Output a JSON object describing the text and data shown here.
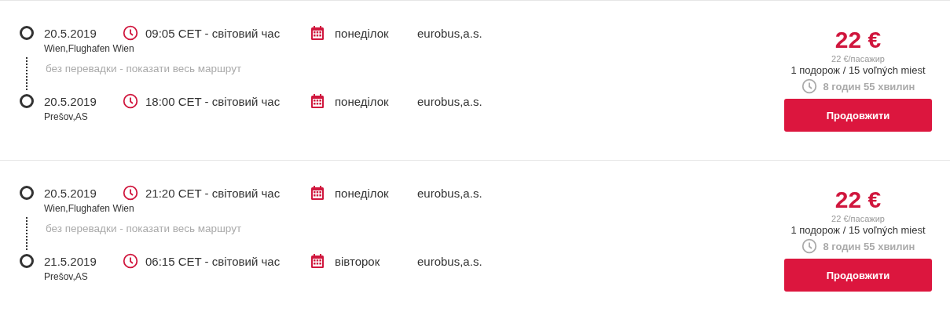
{
  "trips": [
    {
      "stops": [
        {
          "date": "20.5.2019",
          "time": "09:05 CET - світовий час",
          "day": "понеділок",
          "operator": "eurobus,a.s.",
          "place": "Wien,Flughafen Wien"
        },
        {
          "date": "20.5.2019",
          "time": "18:00 CET - світовий час",
          "day": "понеділок",
          "operator": "eurobus,a.s.",
          "place": "Prešov,AS"
        }
      ],
      "transfer_link": "без перевадки - показати весь маршрут",
      "price": "22 €",
      "price_per_passenger": "22 €/пасажир",
      "availability": "1 подорож / 15 voľných miest",
      "duration": "8 годин 55 хвилин",
      "button": "Продовжити"
    },
    {
      "stops": [
        {
          "date": "20.5.2019",
          "time": "21:20 CET - світовий час",
          "day": "понеділок",
          "operator": "eurobus,a.s.",
          "place": "Wien,Flughafen Wien"
        },
        {
          "date": "21.5.2019",
          "time": "06:15 CET - світовий час",
          "day": "вівторок",
          "operator": "eurobus,a.s.",
          "place": "Prešov,AS"
        }
      ],
      "transfer_link": "без перевадки - показати весь маршрут",
      "price": "22 €",
      "price_per_passenger": "22 €/пасажир",
      "availability": "1 подорож / 15 voľných miest",
      "duration": "8 годин 55 хвилин",
      "button": "Продовжити"
    }
  ]
}
